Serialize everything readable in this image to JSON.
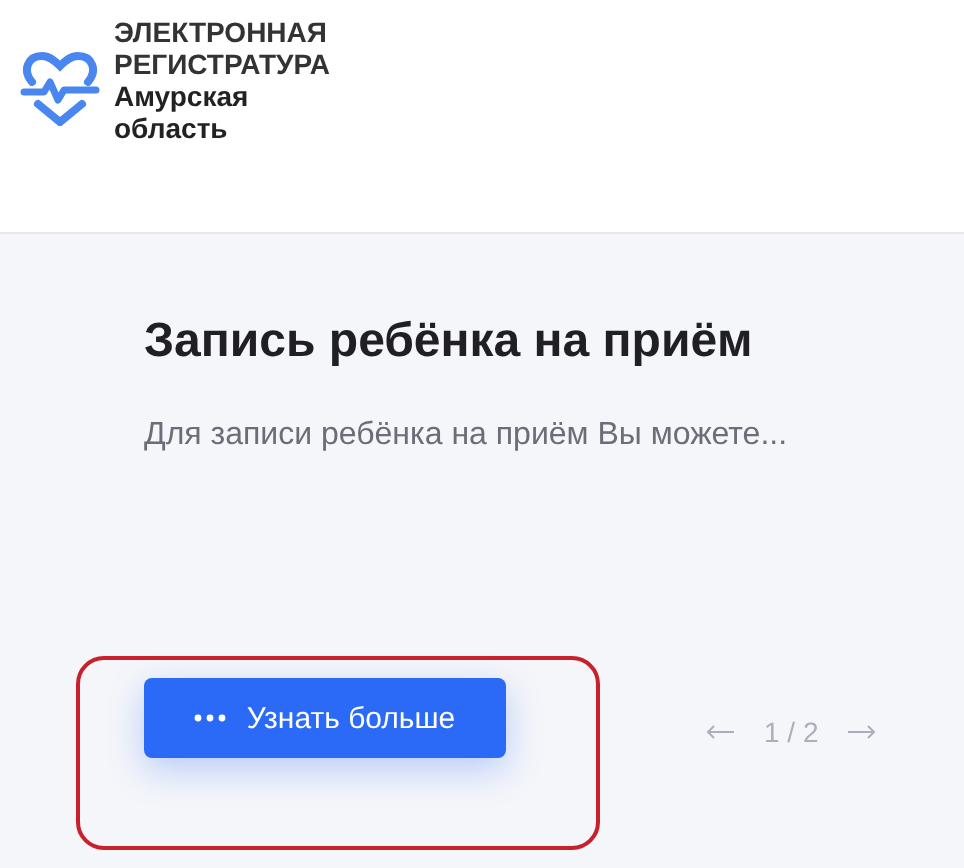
{
  "header": {
    "logo_lines": [
      "ЭЛЕКТРОННАЯ",
      "РЕГИСТРАТУРА",
      "Амурская",
      "область"
    ]
  },
  "slide": {
    "title": "Запись ребёнка на приём",
    "text": "Для записи ребёнка на приём Вы можете...",
    "button": "Узнать больше",
    "highlighted": true
  },
  "pager": {
    "current": "1 / 2"
  }
}
